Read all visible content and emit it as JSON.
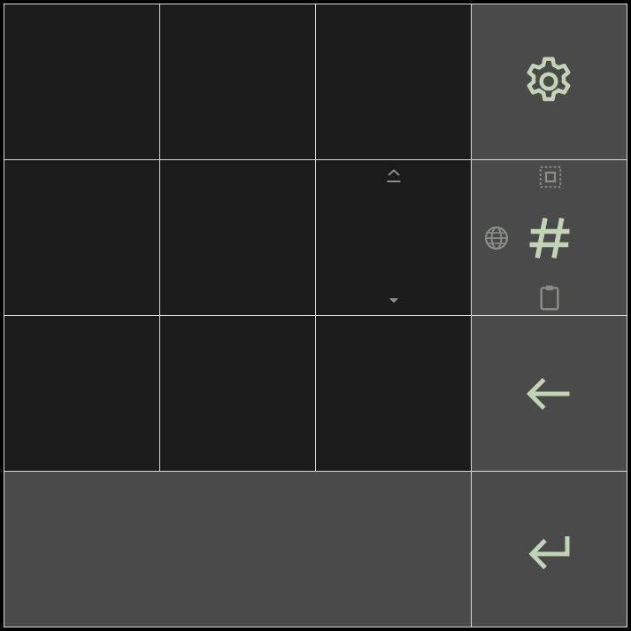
{
  "keyboard": {
    "keys": [
      {
        "name": "key-r1c1"
      },
      {
        "name": "key-r1c2"
      },
      {
        "name": "key-r1c3"
      },
      {
        "name": "key-r2c1"
      },
      {
        "name": "key-r2c2"
      },
      {
        "name": "key-r2c3"
      },
      {
        "name": "key-r3c1"
      },
      {
        "name": "key-r3c2"
      },
      {
        "name": "key-r3c3"
      }
    ],
    "settings_icon": "gear-icon",
    "symbols_icon": "hash-icon",
    "language_icon": "globe-icon",
    "select_all_icon": "select-all-icon",
    "clipboard_icon": "clipboard-icon",
    "hide_keyboard_icon": "eject-icon",
    "dropdown_icon": "triangle-down-icon",
    "backspace_icon": "arrow-left-icon",
    "enter_icon": "enter-return-icon"
  },
  "colors": {
    "background": "#000000",
    "key_dark": "#1b1b1b",
    "key_function": "#4a4a4a",
    "key_border": "#d8d8d8",
    "icon_primary": "#c3d3b6",
    "icon_secondary": "#8a8f86"
  }
}
